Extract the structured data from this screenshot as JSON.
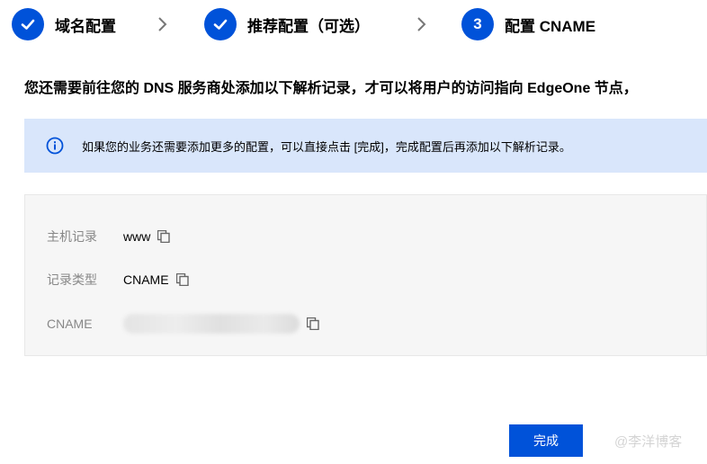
{
  "steps": [
    {
      "label": "域名配置",
      "state": "done",
      "icon": "check-icon"
    },
    {
      "label": "推荐配置（可选）",
      "state": "done",
      "icon": "check-icon"
    },
    {
      "label": "配置 CNAME",
      "state": "current",
      "number": "3"
    }
  ],
  "instruction": "您还需要前往您的 DNS 服务商处添加以下解析记录，才可以将用户的访问指向 EdgeOne 节点，",
  "info_banner": {
    "icon": "info-icon",
    "text": "如果您的业务还需要添加更多的配置，可以直接点击 [完成]，完成配置后再添加以下解析记录。"
  },
  "record": {
    "host_label": "主机记录",
    "host_value": "www",
    "type_label": "记录类型",
    "type_value": "CNAME",
    "cname_label": "CNAME",
    "copy_icon": "copy-icon"
  },
  "footer": {
    "done_label": "完成",
    "watermark": "@李洋博客"
  },
  "colors": {
    "primary": "#0052d9",
    "banner_bg": "#d9e6fb",
    "panel_bg": "#f6f6f6"
  }
}
